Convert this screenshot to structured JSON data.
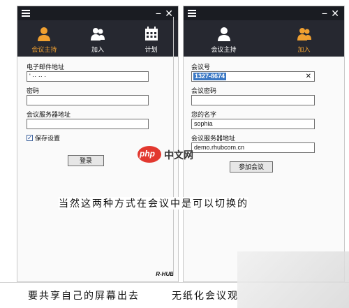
{
  "left_window": {
    "nav": [
      {
        "label": "会议主持",
        "icon": "person-icon",
        "active": true
      },
      {
        "label": "加入",
        "icon": "people-icon",
        "active": false
      },
      {
        "label": "计划",
        "icon": "calendar-icon",
        "active": false
      }
    ],
    "fields": {
      "email_label": "电子邮件地址",
      "email_value": "' ·· ·· ·",
      "password_label": "密码",
      "password_value": "",
      "server_label": "会议服务器地址",
      "server_value": ""
    },
    "save_settings_label": "保存设置",
    "save_settings_checked": true,
    "login_button": "登录",
    "brand": "R-HUB"
  },
  "right_window": {
    "nav": [
      {
        "label": "会议主持",
        "icon": "person-icon",
        "active": false
      },
      {
        "label": "加入",
        "icon": "people-icon",
        "active": true
      }
    ],
    "fields": {
      "meeting_id_label": "会议号",
      "meeting_id_value": "1327-8674",
      "meeting_password_label": "会议密码",
      "meeting_password_value": "",
      "your_name_label": "您的名字",
      "your_name_value": "sophia",
      "server_label": "会议服务器地址",
      "server_value": "demo.rhubcom.cn"
    },
    "join_button": "参加会议"
  },
  "captions": {
    "center": "当然这两种方式在会议中是可以切换的",
    "bottom_left": "要共享自己的屏幕出去",
    "bottom_right": "无纸化会议观"
  },
  "watermark": {
    "php": "php",
    "site": "中文网"
  },
  "colors": {
    "accent": "#f0a030",
    "titlebar": "#1a1c22",
    "navbar": "#262830"
  }
}
